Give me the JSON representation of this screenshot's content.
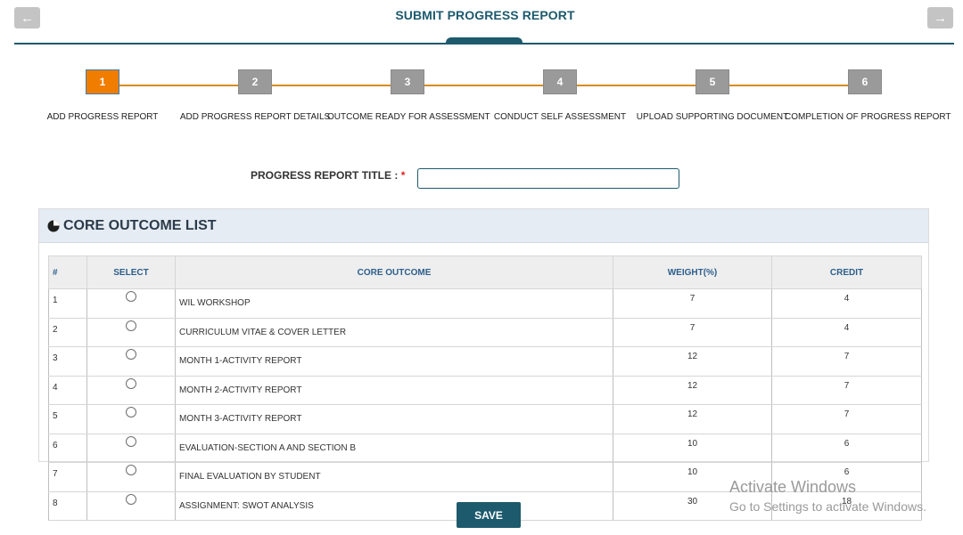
{
  "header": {
    "title": "SUBMIT PROGRESS REPORT",
    "prev_icon": "arrow-left-icon",
    "next_icon": "arrow-right-icon"
  },
  "steps": [
    {
      "number": "1",
      "label": "ADD PROGRESS REPORT",
      "active": true
    },
    {
      "number": "2",
      "label": "ADD PROGRESS REPORT DETAILS",
      "active": false
    },
    {
      "number": "3",
      "label": "OUTCOME READY FOR ASSESSMENT",
      "active": false
    },
    {
      "number": "4",
      "label": "CONDUCT SELF ASSESSMENT",
      "active": false
    },
    {
      "number": "5",
      "label": "UPLOAD SUPPORTING DOCUMENT",
      "active": false
    },
    {
      "number": "6",
      "label": "COMPLETION OF PROGRESS REPORT",
      "active": false
    }
  ],
  "form": {
    "title_label": "PROGRESS REPORT TITLE :",
    "required_mark": "*",
    "title_value": ""
  },
  "outcome_list": {
    "heading": "CORE OUTCOME LIST",
    "icon": "pie-chart-icon",
    "columns": [
      "#",
      "SELECT",
      "CORE OUTCOME",
      "WEIGHT(%)",
      "CREDIT"
    ],
    "rows": [
      {
        "num": "1",
        "outcome": "WIL WORKSHOP",
        "weight": "7",
        "credit": "4"
      },
      {
        "num": "2",
        "outcome": "CURRICULUM VITAE & COVER LETTER",
        "weight": "7",
        "credit": "4"
      },
      {
        "num": "3",
        "outcome": "MONTH 1-ACTIVITY REPORT",
        "weight": "12",
        "credit": "7"
      },
      {
        "num": "4",
        "outcome": "MONTH 2-ACTIVITY REPORT",
        "weight": "12",
        "credit": "7"
      },
      {
        "num": "5",
        "outcome": "MONTH 3-ACTIVITY REPORT",
        "weight": "12",
        "credit": "7"
      },
      {
        "num": "6",
        "outcome": "EVALUATION-SECTION A AND SECTION B",
        "weight": "10",
        "credit": "6"
      },
      {
        "num": "7",
        "outcome": "FINAL EVALUATION BY STUDENT",
        "weight": "10",
        "credit": "6"
      },
      {
        "num": "8",
        "outcome": "ASSIGNMENT: SWOT ANALYSIS",
        "weight": "30",
        "credit": "18"
      }
    ]
  },
  "actions": {
    "save_label": "SAVE"
  },
  "watermark": {
    "line1": "Activate Windows",
    "line2": "Go to Settings to activate Windows."
  },
  "colors": {
    "brand": "#1d5a6d",
    "active_step": "#f07d00",
    "inactive_step": "#9a9a9a",
    "step_line": "#d98a1f"
  }
}
